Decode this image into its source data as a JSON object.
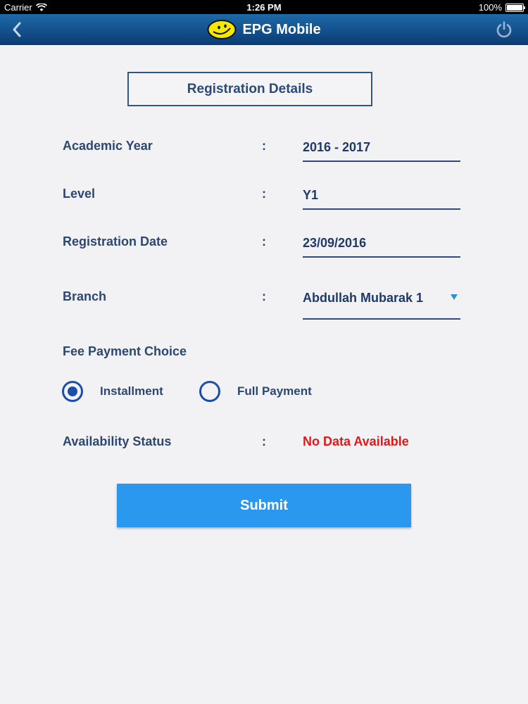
{
  "status_bar": {
    "carrier": "Carrier",
    "time": "1:26 PM",
    "battery": "100%",
    "battery_level": 1.0
  },
  "nav": {
    "title": "EPG Mobile"
  },
  "section_title": "Registration Details",
  "fields": {
    "academic_year": {
      "label": "Academic Year",
      "colon": ":",
      "value": "2016 - 2017"
    },
    "level": {
      "label": "Level",
      "colon": ":",
      "value": "Y1"
    },
    "registration_date": {
      "label": "Registration Date",
      "colon": ":",
      "value": "23/09/2016"
    },
    "branch": {
      "label": "Branch",
      "colon": ":",
      "value": "Abdullah Mubarak 1"
    }
  },
  "fee_payment": {
    "label": "Fee Payment Choice",
    "options": [
      {
        "label": "Installment",
        "selected": true
      },
      {
        "label": "Full Payment",
        "selected": false
      }
    ]
  },
  "availability": {
    "label": "Availability Status",
    "colon": ":",
    "value": "No Data Available"
  },
  "submit_label": "Submit",
  "colors": {
    "nav_top": "#1e6aa8",
    "nav_bottom": "#0b3b73",
    "accent": "#2b98f0",
    "error": "#e01818",
    "text": "#2c4770"
  },
  "icons": [
    "wifi-icon",
    "battery-icon",
    "back-chevron-icon",
    "smiley-logo-icon",
    "power-icon",
    "dropdown-arrow-icon"
  ]
}
